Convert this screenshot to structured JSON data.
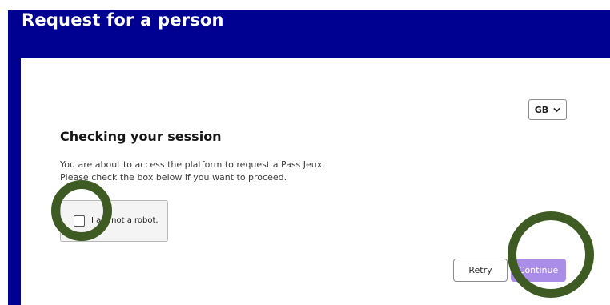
{
  "header": {
    "title": "Request for a person"
  },
  "language": {
    "selected": "GB",
    "icon": "chevron-down-icon"
  },
  "session_check": {
    "heading": "Checking your session",
    "description_line1": "You are about to access the platform to request a Pass Jeux.",
    "description_line2": "Please check the box below if you want to proceed.",
    "captcha_label": "I am not a robot.",
    "checkbox_checked": false
  },
  "actions": {
    "retry_label": "Retry",
    "continue_label": "Continue"
  },
  "colors": {
    "header_bg": "#000091",
    "continue_bg": "#a98de8",
    "annotation_ring": "#3e5b23"
  }
}
